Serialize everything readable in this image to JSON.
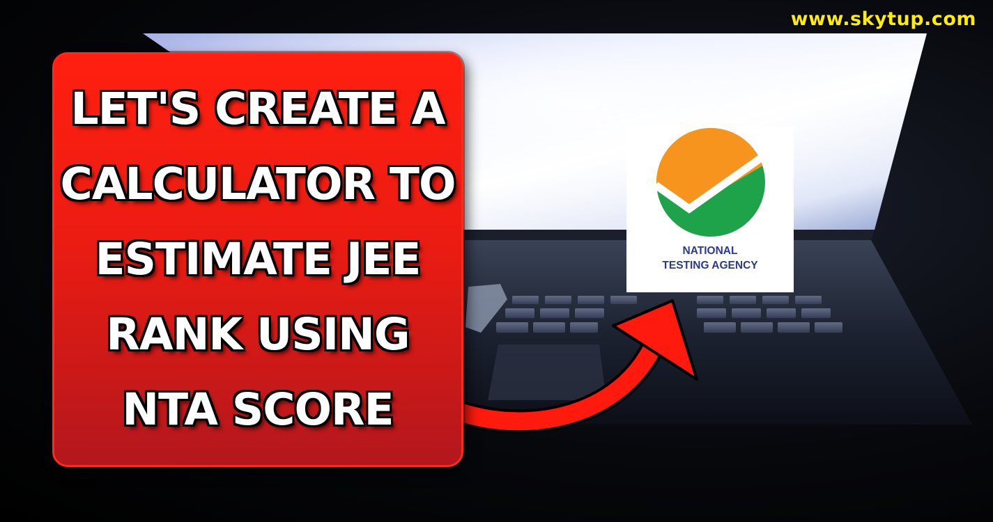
{
  "watermark": {
    "text": "www.skytup.com",
    "color": "#ffee00"
  },
  "headline": {
    "lines": [
      "LET'S CREATE A",
      "CALCULATOR TO",
      "ESTIMATE JEE",
      "RANK USING",
      "NTA SCORE"
    ],
    "card_color": "#e81d12",
    "text_color": "#ffffff"
  },
  "logo": {
    "line1": "NATIONAL",
    "line2": "TESTING AGENCY",
    "orange": "#f7941d",
    "green": "#1ea24a",
    "text_color": "#2b3a8c"
  },
  "arrow": {
    "icon": "curved-arrow-icon",
    "color": "#ff1a0e"
  },
  "background": {
    "subject": "laptop-in-dark-room"
  }
}
